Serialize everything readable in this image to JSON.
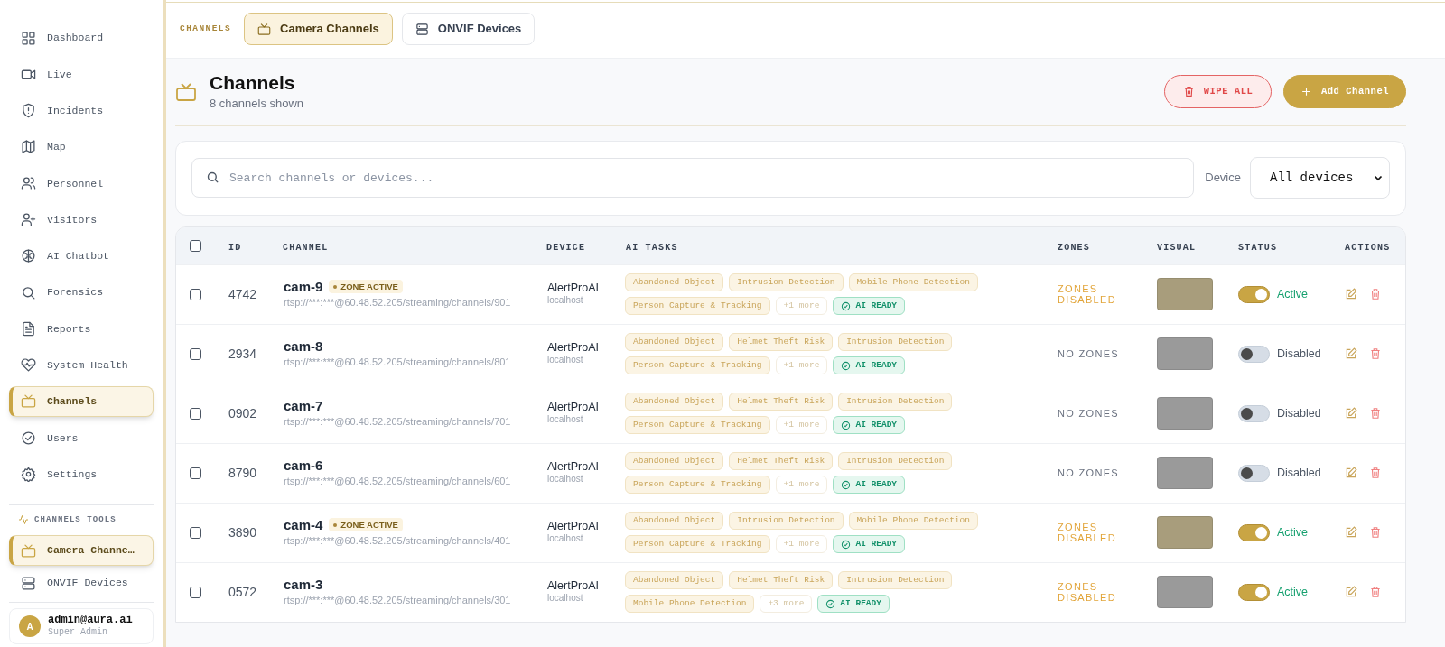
{
  "sidebar": {
    "items": [
      {
        "label": "Dashboard",
        "selected": false
      },
      {
        "label": "Live",
        "selected": false
      },
      {
        "label": "Incidents",
        "selected": false
      },
      {
        "label": "Map",
        "selected": false
      },
      {
        "label": "Personnel",
        "selected": false
      },
      {
        "label": "Visitors",
        "selected": false
      },
      {
        "label": "AI Chatbot",
        "selected": false
      },
      {
        "label": "Forensics",
        "selected": false
      },
      {
        "label": "Reports",
        "selected": false
      },
      {
        "label": "System Health",
        "selected": false
      },
      {
        "label": "Channels",
        "selected": true
      },
      {
        "label": "Users",
        "selected": false
      },
      {
        "label": "Settings",
        "selected": false
      }
    ],
    "tools_title": "CHANNELS TOOLS",
    "tools": [
      {
        "label": "Camera Channe…",
        "selected": true
      },
      {
        "label": "ONVIF Devices",
        "selected": false
      }
    ],
    "user": {
      "avatar": "A",
      "email": "admin@aura.ai",
      "role": "Super Admin"
    }
  },
  "top_tabs": {
    "label": "CHANNELS",
    "tabs": [
      {
        "label": "Camera Channels",
        "selected": true
      },
      {
        "label": "ONVIF Devices",
        "selected": false
      }
    ]
  },
  "header": {
    "title": "Channels",
    "subtitle": "8 channels shown",
    "buttons": [
      {
        "label": "WIPE ALL",
        "kind": "danger"
      },
      {
        "label": "Add Channel",
        "kind": "primary"
      }
    ]
  },
  "filters": {
    "search_placeholder": "Search channels or devices...",
    "device_label": "Device",
    "device_value": "All devices"
  },
  "table": {
    "all_checked": false,
    "columns": [
      "ID",
      "CHANNEL",
      "DEVICE",
      "AI TASKS",
      "ZONES",
      "VISUAL",
      "STATUS",
      "ACTIONS"
    ],
    "rows": [
      {
        "checked": false,
        "id": "4742",
        "name": "cam-9",
        "badge": "ZONE ACTIVE",
        "url": "rtsp://***:***@60.48.52.205/streaming/channels/901",
        "device": "AlertProAI",
        "host": "localhost",
        "tasks": [
          {
            "kind": "task",
            "label": "Abandoned Object"
          },
          {
            "kind": "task",
            "label": "Intrusion Detection"
          },
          {
            "kind": "task",
            "label": "Mobile Phone Detection"
          },
          {
            "kind": "task",
            "label": "Person Capture & Tracking"
          },
          {
            "kind": "more",
            "label": "+1 more"
          },
          {
            "kind": "ready",
            "label": "AI READY"
          }
        ],
        "zones": {
          "kind": "disabled",
          "label": "ZONES DISABLED"
        },
        "visual": {
          "color": "#a89d7c"
        },
        "status": {
          "on": true,
          "label": "Active"
        }
      },
      {
        "checked": false,
        "id": "2934",
        "name": "cam-8",
        "url": "rtsp://***:***@60.48.52.205/streaming/channels/801",
        "device": "AlertProAI",
        "host": "localhost",
        "tasks": [
          {
            "kind": "task",
            "label": "Abandoned Object"
          },
          {
            "kind": "task",
            "label": "Helmet Theft Risk"
          },
          {
            "kind": "task",
            "label": "Intrusion Detection"
          },
          {
            "kind": "task",
            "label": "Person Capture & Tracking"
          },
          {
            "kind": "more",
            "label": "+1 more"
          },
          {
            "kind": "ready",
            "label": "AI READY"
          }
        ],
        "zones": {
          "kind": "none",
          "label": "NO ZONES"
        },
        "visual": {
          "color": "#9a9a9a"
        },
        "status": {
          "on": false,
          "label": "Disabled"
        }
      },
      {
        "checked": false,
        "id": "0902",
        "name": "cam-7",
        "url": "rtsp://***:***@60.48.52.205/streaming/channels/701",
        "device": "AlertProAI",
        "host": "localhost",
        "tasks": [
          {
            "kind": "task",
            "label": "Abandoned Object"
          },
          {
            "kind": "task",
            "label": "Helmet Theft Risk"
          },
          {
            "kind": "task",
            "label": "Intrusion Detection"
          },
          {
            "kind": "task",
            "label": "Person Capture & Tracking"
          },
          {
            "kind": "more",
            "label": "+1 more"
          },
          {
            "kind": "ready",
            "label": "AI READY"
          }
        ],
        "zones": {
          "kind": "none",
          "label": "NO ZONES"
        },
        "visual": {
          "color": "#9a9a9a"
        },
        "status": {
          "on": false,
          "label": "Disabled"
        }
      },
      {
        "checked": false,
        "id": "8790",
        "name": "cam-6",
        "url": "rtsp://***:***@60.48.52.205/streaming/channels/601",
        "device": "AlertProAI",
        "host": "localhost",
        "tasks": [
          {
            "kind": "task",
            "label": "Abandoned Object"
          },
          {
            "kind": "task",
            "label": "Helmet Theft Risk"
          },
          {
            "kind": "task",
            "label": "Intrusion Detection"
          },
          {
            "kind": "task",
            "label": "Person Capture & Tracking"
          },
          {
            "kind": "more",
            "label": "+1 more"
          },
          {
            "kind": "ready",
            "label": "AI READY"
          }
        ],
        "zones": {
          "kind": "none",
          "label": "NO ZONES"
        },
        "visual": {
          "color": "#9a9a9a"
        },
        "status": {
          "on": false,
          "label": "Disabled"
        }
      },
      {
        "checked": false,
        "id": "3890",
        "name": "cam-4",
        "badge": "ZONE ACTIVE",
        "url": "rtsp://***:***@60.48.52.205/streaming/channels/401",
        "device": "AlertProAI",
        "host": "localhost",
        "tasks": [
          {
            "kind": "task",
            "label": "Abandoned Object"
          },
          {
            "kind": "task",
            "label": "Intrusion Detection"
          },
          {
            "kind": "task",
            "label": "Mobile Phone Detection"
          },
          {
            "kind": "task",
            "label": "Person Capture & Tracking"
          },
          {
            "kind": "more",
            "label": "+1 more"
          },
          {
            "kind": "ready",
            "label": "AI READY"
          }
        ],
        "zones": {
          "kind": "disabled",
          "label": "ZONES DISABLED"
        },
        "visual": {
          "color": "#a89d7c"
        },
        "status": {
          "on": true,
          "label": "Active"
        }
      },
      {
        "checked": false,
        "id": "0572",
        "name": "cam-3",
        "url": "rtsp://***:***@60.48.52.205/streaming/channels/301",
        "device": "AlertProAI",
        "host": "localhost",
        "tasks": [
          {
            "kind": "task",
            "label": "Abandoned Object"
          },
          {
            "kind": "task",
            "label": "Helmet Theft Risk"
          },
          {
            "kind": "task",
            "label": "Intrusion Detection"
          },
          {
            "kind": "task",
            "label": "Mobile Phone Detection"
          },
          {
            "kind": "more",
            "label": "+3 more"
          },
          {
            "kind": "ready",
            "label": "AI READY"
          }
        ],
        "zones": {
          "kind": "disabled",
          "label": "ZONES DISABLED"
        },
        "visual": {
          "color": "#9a9a9a"
        },
        "status": {
          "on": true,
          "label": "Active"
        }
      }
    ]
  }
}
